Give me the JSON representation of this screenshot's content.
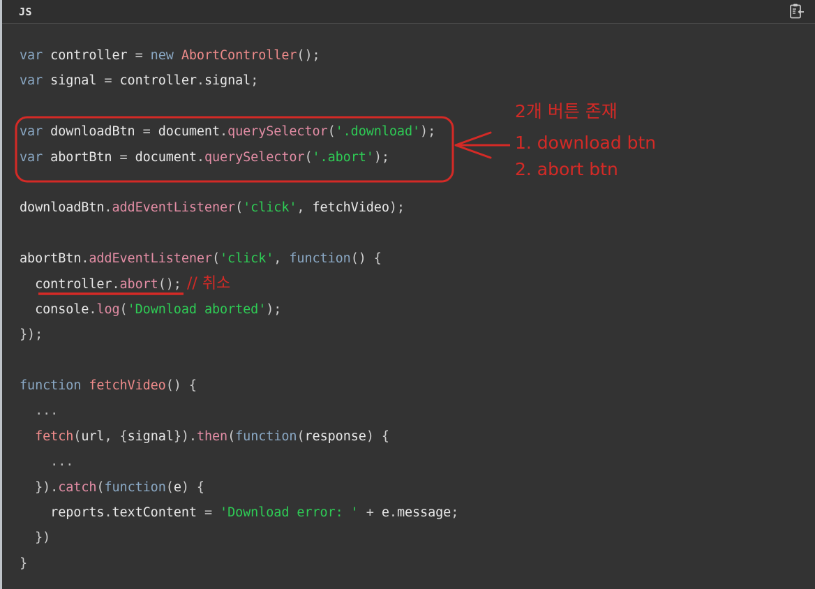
{
  "header": {
    "language_label": "JS",
    "copy_icon": "clipboard-paste-icon"
  },
  "colors": {
    "background": "#333333",
    "header_background": "#2f2f2f",
    "annotation_red": "#d42a26",
    "string_green": "#2ecc55",
    "keyword_blue": "#8aa8c4",
    "class_salmon": "#ef8b8b",
    "method_pink": "#e38da5",
    "plain_text": "#e8e8e8",
    "left_border": "#bfc4c9"
  },
  "code": {
    "lines": [
      [
        {
          "t": "var ",
          "c": "kw"
        },
        {
          "t": "controller",
          "c": "pl"
        },
        {
          "t": " = ",
          "c": "punc"
        },
        {
          "t": "new ",
          "c": "kw"
        },
        {
          "t": "AbortController",
          "c": "cls"
        },
        {
          "t": "();",
          "c": "punc"
        }
      ],
      [
        {
          "t": "var ",
          "c": "kw"
        },
        {
          "t": "signal",
          "c": "pl"
        },
        {
          "t": " = ",
          "c": "punc"
        },
        {
          "t": "controller",
          "c": "pl"
        },
        {
          "t": ".",
          "c": "punc"
        },
        {
          "t": "signal",
          "c": "pl"
        },
        {
          "t": ";",
          "c": "punc"
        }
      ],
      [
        {
          "t": "",
          "c": "pl"
        }
      ],
      [
        {
          "t": "var ",
          "c": "kw"
        },
        {
          "t": "downloadBtn",
          "c": "pl"
        },
        {
          "t": " = ",
          "c": "punc"
        },
        {
          "t": "document",
          "c": "pl"
        },
        {
          "t": ".",
          "c": "punc"
        },
        {
          "t": "querySelector",
          "c": "fn"
        },
        {
          "t": "(",
          "c": "punc"
        },
        {
          "t": "'.download'",
          "c": "str"
        },
        {
          "t": ");",
          "c": "punc"
        }
      ],
      [
        {
          "t": "var ",
          "c": "kw"
        },
        {
          "t": "abortBtn",
          "c": "pl"
        },
        {
          "t": " = ",
          "c": "punc"
        },
        {
          "t": "document",
          "c": "pl"
        },
        {
          "t": ".",
          "c": "punc"
        },
        {
          "t": "querySelector",
          "c": "fn"
        },
        {
          "t": "(",
          "c": "punc"
        },
        {
          "t": "'.abort'",
          "c": "str"
        },
        {
          "t": ");",
          "c": "punc"
        }
      ],
      [
        {
          "t": "",
          "c": "pl"
        }
      ],
      [
        {
          "t": "downloadBtn",
          "c": "pl"
        },
        {
          "t": ".",
          "c": "punc"
        },
        {
          "t": "addEventListener",
          "c": "fn"
        },
        {
          "t": "(",
          "c": "punc"
        },
        {
          "t": "'click'",
          "c": "str"
        },
        {
          "t": ", ",
          "c": "punc"
        },
        {
          "t": "fetchVideo",
          "c": "pl"
        },
        {
          "t": ");",
          "c": "punc"
        }
      ],
      [
        {
          "t": "",
          "c": "pl"
        }
      ],
      [
        {
          "t": "abortBtn",
          "c": "pl"
        },
        {
          "t": ".",
          "c": "punc"
        },
        {
          "t": "addEventListener",
          "c": "fn"
        },
        {
          "t": "(",
          "c": "punc"
        },
        {
          "t": "'click'",
          "c": "str"
        },
        {
          "t": ", ",
          "c": "punc"
        },
        {
          "t": "function",
          "c": "kw"
        },
        {
          "t": "() {",
          "c": "punc"
        }
      ],
      [
        {
          "t": "  ",
          "c": "punc"
        },
        {
          "t": "controller",
          "c": "pl"
        },
        {
          "t": ".",
          "c": "punc"
        },
        {
          "t": "abort",
          "c": "fn"
        },
        {
          "t": "();",
          "c": "punc"
        }
      ],
      [
        {
          "t": "  ",
          "c": "punc"
        },
        {
          "t": "console",
          "c": "pl"
        },
        {
          "t": ".",
          "c": "punc"
        },
        {
          "t": "log",
          "c": "fn"
        },
        {
          "t": "(",
          "c": "punc"
        },
        {
          "t": "'Download aborted'",
          "c": "str"
        },
        {
          "t": ");",
          "c": "punc"
        }
      ],
      [
        {
          "t": "});",
          "c": "punc"
        }
      ],
      [
        {
          "t": "",
          "c": "pl"
        }
      ],
      [
        {
          "t": "function ",
          "c": "kw"
        },
        {
          "t": "fetchVideo",
          "c": "cls"
        },
        {
          "t": "() {",
          "c": "punc"
        }
      ],
      [
        {
          "t": "  ",
          "c": "punc"
        },
        {
          "t": "...",
          "c": "dim"
        }
      ],
      [
        {
          "t": "  ",
          "c": "punc"
        },
        {
          "t": "fetch",
          "c": "cls"
        },
        {
          "t": "(",
          "c": "punc"
        },
        {
          "t": "url",
          "c": "pl"
        },
        {
          "t": ", {",
          "c": "punc"
        },
        {
          "t": "signal",
          "c": "pl"
        },
        {
          "t": "}).",
          "c": "punc"
        },
        {
          "t": "then",
          "c": "fn"
        },
        {
          "t": "(",
          "c": "punc"
        },
        {
          "t": "function",
          "c": "kw"
        },
        {
          "t": "(",
          "c": "punc"
        },
        {
          "t": "response",
          "c": "pl"
        },
        {
          "t": ") {",
          "c": "punc"
        }
      ],
      [
        {
          "t": "    ",
          "c": "punc"
        },
        {
          "t": "...",
          "c": "dim"
        }
      ],
      [
        {
          "t": "  ",
          "c": "punc"
        },
        {
          "t": "}).",
          "c": "punc"
        },
        {
          "t": "catch",
          "c": "fn"
        },
        {
          "t": "(",
          "c": "punc"
        },
        {
          "t": "function",
          "c": "kw"
        },
        {
          "t": "(",
          "c": "punc"
        },
        {
          "t": "e",
          "c": "pl"
        },
        {
          "t": ") {",
          "c": "punc"
        }
      ],
      [
        {
          "t": "    ",
          "c": "punc"
        },
        {
          "t": "reports",
          "c": "pl"
        },
        {
          "t": ".",
          "c": "punc"
        },
        {
          "t": "textContent",
          "c": "pl"
        },
        {
          "t": " = ",
          "c": "punc"
        },
        {
          "t": "'Download error: '",
          "c": "str"
        },
        {
          "t": " + ",
          "c": "punc"
        },
        {
          "t": "e",
          "c": "pl"
        },
        {
          "t": ".",
          "c": "punc"
        },
        {
          "t": "message",
          "c": "pl"
        },
        {
          "t": ";",
          "c": "punc"
        }
      ],
      [
        {
          "t": "  ",
          "c": "punc"
        },
        {
          "t": "})",
          "c": "punc"
        }
      ],
      [
        {
          "t": "}",
          "c": "punc"
        }
      ]
    ]
  },
  "annotations": {
    "callout_heading": "2개 버튼 존재",
    "callout_item_1": "1. download btn",
    "callout_item_2": "2. abort btn",
    "inline_comment": "// 취소"
  }
}
